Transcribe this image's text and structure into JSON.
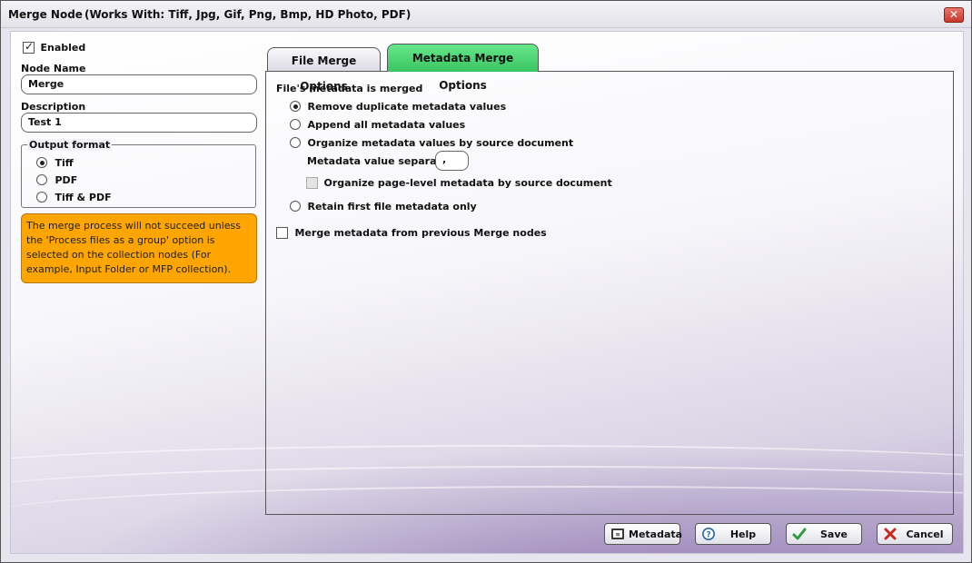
{
  "window": {
    "title": "Merge Node",
    "works_with": "(Works With: Tiff, Jpg, Gif, Png, Bmp, HD Photo, PDF)",
    "close_label": "✕"
  },
  "left": {
    "enabled_label": "Enabled",
    "enabled_checked": true,
    "node_name_label": "Node Name",
    "node_name_value": "Merge",
    "description_label": "Description",
    "description_value": "Test 1",
    "output_format": {
      "legend": "Output format",
      "options": [
        "Tiff",
        "PDF",
        "Tiff & PDF"
      ],
      "selected": "Tiff"
    },
    "note": "The merge process will not succeed unless the 'Process files as a group' option is selected on the collection nodes (For example, Input Folder or MFP collection)."
  },
  "tabs": [
    {
      "label": "File Merge Options",
      "active": false
    },
    {
      "label": "Metadata Merge Options",
      "active": true
    }
  ],
  "metadata_tab": {
    "heading": "File's metadata is merged",
    "options": [
      "Remove duplicate metadata values",
      "Append all metadata values",
      "Organize metadata values by source document",
      "Retain first file metadata only"
    ],
    "selected": "Remove duplicate metadata values",
    "separator_label": "Metadata value separator:",
    "separator_value": ",",
    "page_level_label": "Organize page-level metadata by source document",
    "page_level_checked": false,
    "merge_previous_label": "Merge metadata from previous Merge nodes",
    "merge_previous_checked": false
  },
  "buttons": {
    "metadata": "Metadata",
    "help": "Help",
    "save": "Save",
    "cancel": "Cancel"
  },
  "colors": {
    "active_tab": "#3fcf6a",
    "note_bg": "#ffa500",
    "close_button": "#d0473b"
  }
}
